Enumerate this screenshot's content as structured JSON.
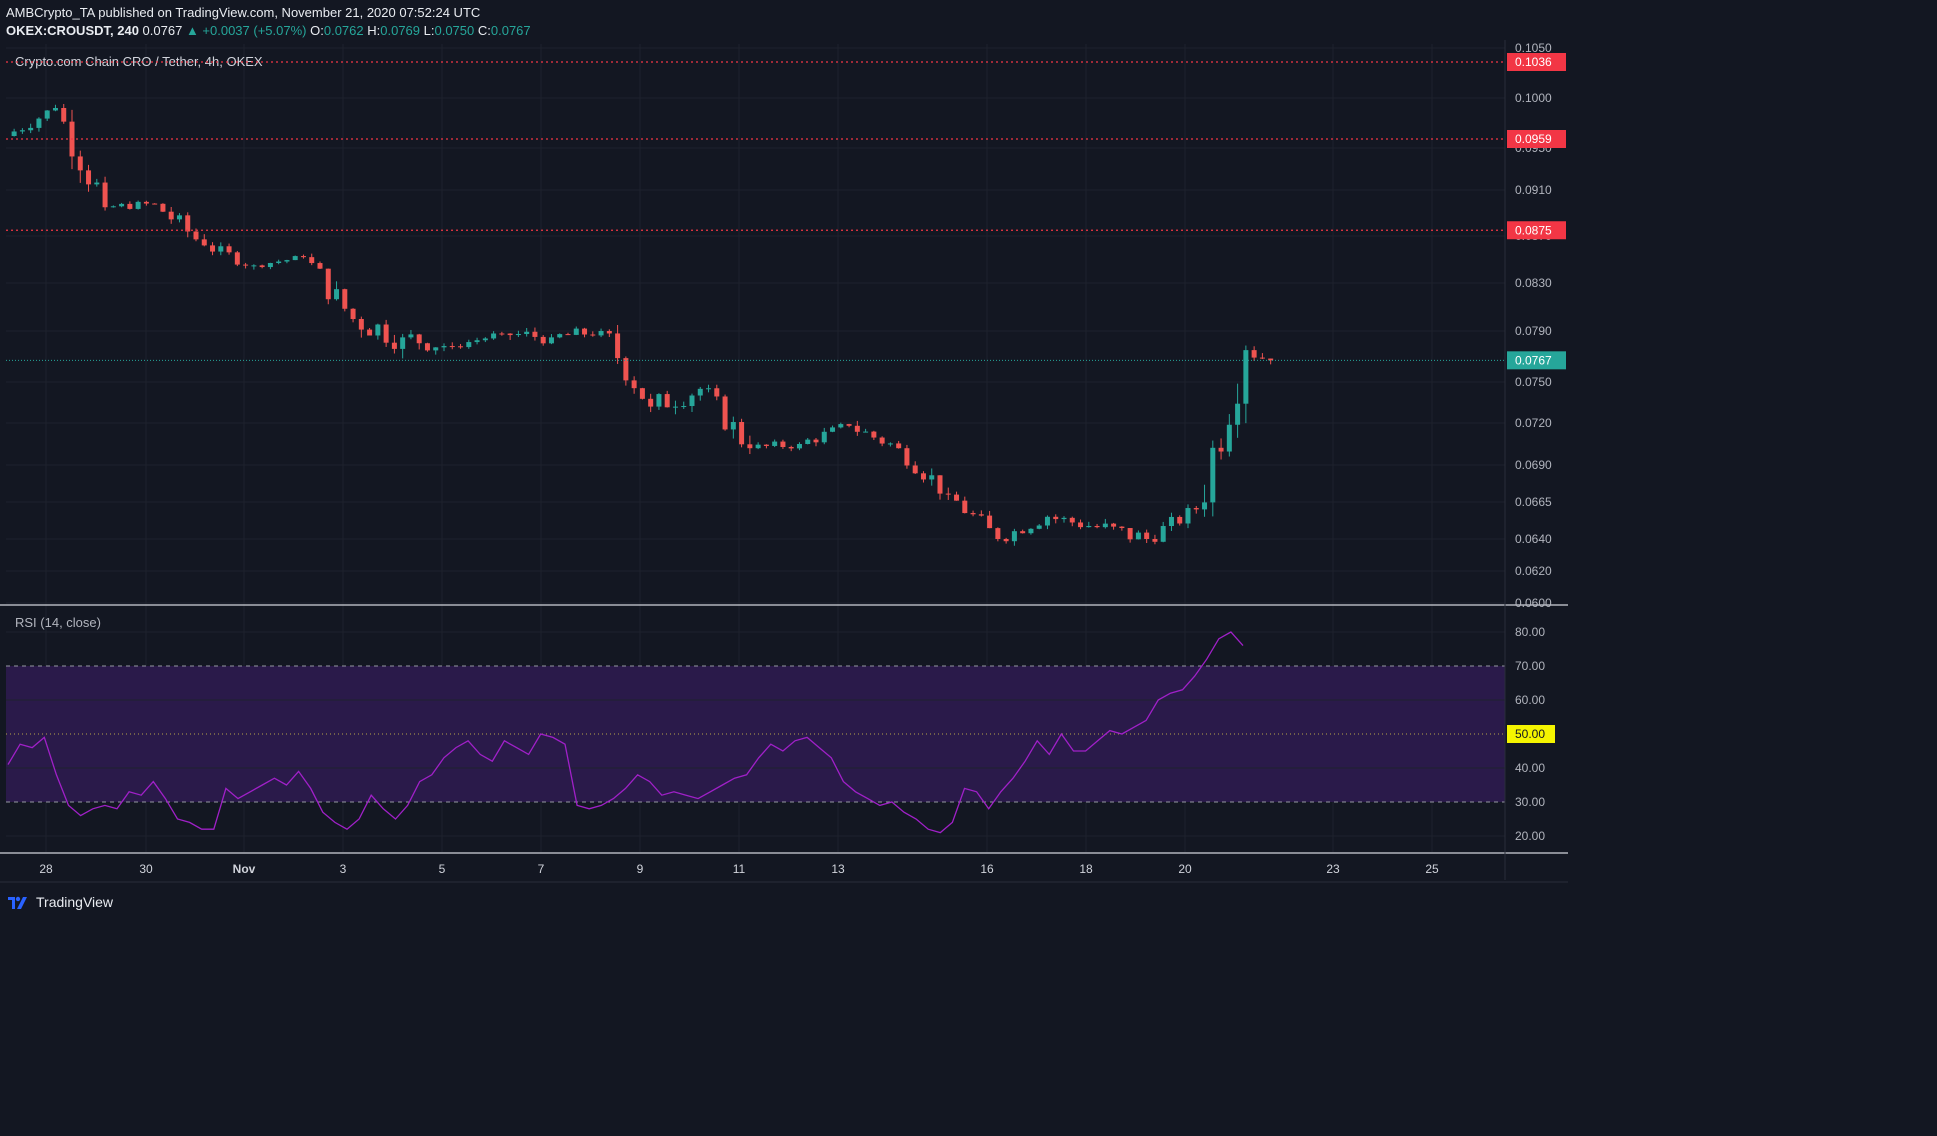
{
  "header": {
    "publisher_line": "AMBCrypto_TA published on TradingView.com, November 21, 2020 07:52:24 UTC",
    "symbol": "OKEX:CROUSDT, 240",
    "price": "0.0767",
    "change": "▲ +0.0037 (+5.07%)",
    "o_label": "O:",
    "o_value": "0.0762",
    "h_label": "H:",
    "h_value": "0.0769",
    "l_label": "L:",
    "l_value": "0.0750",
    "c_label": "C:",
    "c_value": "0.0767"
  },
  "branding": {
    "logo_text": "TradingView",
    "logo_icon": "tradingview-logo-icon"
  },
  "colors": {
    "background": "#131722",
    "grid": "#1e222d",
    "up": "#26a69a",
    "down": "#ef5350",
    "level_line": "#f23645",
    "rsi_line": "#a020c8",
    "rsi_band": "#2a1a4a",
    "rsi_mid_badge": "#f5f500"
  },
  "chart_data": [
    {
      "type": "candlestick",
      "title": "Crypto.com Chain CRO / Tether, 4h, OKEX",
      "x_tick_labels": [
        "28",
        "30",
        "Nov",
        "3",
        "5",
        "7",
        "9",
        "11",
        "13",
        "16",
        "18",
        "20",
        "23",
        "25"
      ],
      "y_tick_labels": [
        "0.1050",
        "0.1000",
        "0.0950",
        "0.0910",
        "0.0870",
        "0.0830",
        "0.0790",
        "0.0750",
        "0.0720",
        "0.0690",
        "0.0665",
        "0.0640",
        "0.0620",
        "0.0600"
      ],
      "last_price_label": "0.0767",
      "horizontal_levels": [
        {
          "value": 0.1036,
          "label": "0.1036",
          "color": "#f23645",
          "style": "dotted"
        },
        {
          "value": 0.0959,
          "label": "0.0959",
          "color": "#f23645",
          "style": "dotted"
        },
        {
          "value": 0.0875,
          "label": "0.0875",
          "color": "#f23645",
          "style": "dotted"
        }
      ],
      "date_range": [
        "Oct 27, 2020",
        "Nov 21, 2020"
      ],
      "ohlc_keypoints": [
        {
          "date": "Oct 27",
          "open": 0.0962,
          "high": 0.0995,
          "low": 0.0955,
          "close": 0.099
        },
        {
          "date": "Oct 28",
          "open": 0.099,
          "high": 0.0994,
          "low": 0.089,
          "close": 0.0895
        },
        {
          "date": "Oct 29",
          "open": 0.0895,
          "high": 0.0905,
          "low": 0.0885,
          "close": 0.0898
        },
        {
          "date": "Oct 30",
          "open": 0.0898,
          "high": 0.091,
          "low": 0.086,
          "close": 0.0862
        },
        {
          "date": "Oct 31",
          "open": 0.0862,
          "high": 0.0865,
          "low": 0.0835,
          "close": 0.0845
        },
        {
          "date": "Nov 1",
          "open": 0.0845,
          "high": 0.0855,
          "low": 0.084,
          "close": 0.0852
        },
        {
          "date": "Nov 2",
          "open": 0.0852,
          "high": 0.0855,
          "low": 0.079,
          "close": 0.08
        },
        {
          "date": "Nov 3",
          "open": 0.08,
          "high": 0.0802,
          "low": 0.0735,
          "close": 0.0785
        },
        {
          "date": "Nov 4",
          "open": 0.0785,
          "high": 0.0798,
          "low": 0.0752,
          "close": 0.0778
        },
        {
          "date": "Nov 5",
          "open": 0.0778,
          "high": 0.0792,
          "low": 0.0775,
          "close": 0.0788
        },
        {
          "date": "Nov 6",
          "open": 0.0788,
          "high": 0.0808,
          "low": 0.0775,
          "close": 0.0785
        },
        {
          "date": "Nov 7",
          "open": 0.0785,
          "high": 0.0798,
          "low": 0.077,
          "close": 0.079
        },
        {
          "date": "Nov 8",
          "open": 0.079,
          "high": 0.0795,
          "low": 0.0728,
          "close": 0.0732
        },
        {
          "date": "Nov 9",
          "open": 0.0732,
          "high": 0.077,
          "low": 0.072,
          "close": 0.0745
        },
        {
          "date": "Nov 10",
          "open": 0.0745,
          "high": 0.0748,
          "low": 0.0692,
          "close": 0.0702
        },
        {
          "date": "Nov 11",
          "open": 0.0702,
          "high": 0.0712,
          "low": 0.0692,
          "close": 0.0705
        },
        {
          "date": "Nov 12",
          "open": 0.0705,
          "high": 0.0725,
          "low": 0.07,
          "close": 0.0718
        },
        {
          "date": "Nov 13",
          "open": 0.0718,
          "high": 0.0725,
          "low": 0.0695,
          "close": 0.0702
        },
        {
          "date": "Nov 14",
          "open": 0.0702,
          "high": 0.0705,
          "low": 0.0665,
          "close": 0.067
        },
        {
          "date": "Nov 15",
          "open": 0.067,
          "high": 0.0672,
          "low": 0.0635,
          "close": 0.064
        },
        {
          "date": "Nov 16",
          "open": 0.064,
          "high": 0.066,
          "low": 0.0635,
          "close": 0.0655
        },
        {
          "date": "Nov 17",
          "open": 0.0655,
          "high": 0.0665,
          "low": 0.0638,
          "close": 0.0648
        },
        {
          "date": "Nov 18",
          "open": 0.0648,
          "high": 0.067,
          "low": 0.0632,
          "close": 0.064
        },
        {
          "date": "Nov 19",
          "open": 0.064,
          "high": 0.0665,
          "low": 0.0635,
          "close": 0.066
        },
        {
          "date": "Nov 20",
          "open": 0.066,
          "high": 0.078,
          "low": 0.0655,
          "close": 0.0775
        },
        {
          "date": "Nov 21",
          "open": 0.0775,
          "high": 0.0785,
          "low": 0.075,
          "close": 0.0767
        }
      ]
    },
    {
      "type": "line",
      "title": "RSI (14, close)",
      "y_tick_labels": [
        "80.00",
        "70.00",
        "60.00",
        "50.00",
        "40.00",
        "30.00",
        "20.00"
      ],
      "levels": [
        70,
        50,
        30
      ],
      "mid_label": "50.00",
      "series": [
        {
          "values": [
            41,
            47,
            46,
            49,
            38,
            29,
            26,
            28,
            29,
            28,
            33,
            32,
            36,
            31,
            25,
            24,
            22,
            22,
            34,
            31,
            33,
            35,
            37,
            35,
            39,
            34,
            27,
            24,
            22,
            25,
            32,
            28,
            25,
            29,
            36,
            38,
            43,
            46,
            48,
            44,
            42,
            48,
            46,
            44,
            50,
            49,
            47,
            29,
            28,
            29,
            31,
            34,
            38,
            36,
            32,
            33,
            32,
            31,
            33,
            35,
            37,
            38,
            43,
            47,
            45,
            48,
            49,
            46,
            43,
            36,
            33,
            31,
            29,
            30,
            27,
            25,
            22,
            21,
            24,
            34,
            33,
            28,
            33,
            37,
            42,
            48,
            44,
            50,
            45,
            45,
            48,
            51,
            50,
            52,
            54,
            60,
            62,
            63,
            67,
            72,
            78,
            80,
            76
          ]
        }
      ]
    }
  ]
}
